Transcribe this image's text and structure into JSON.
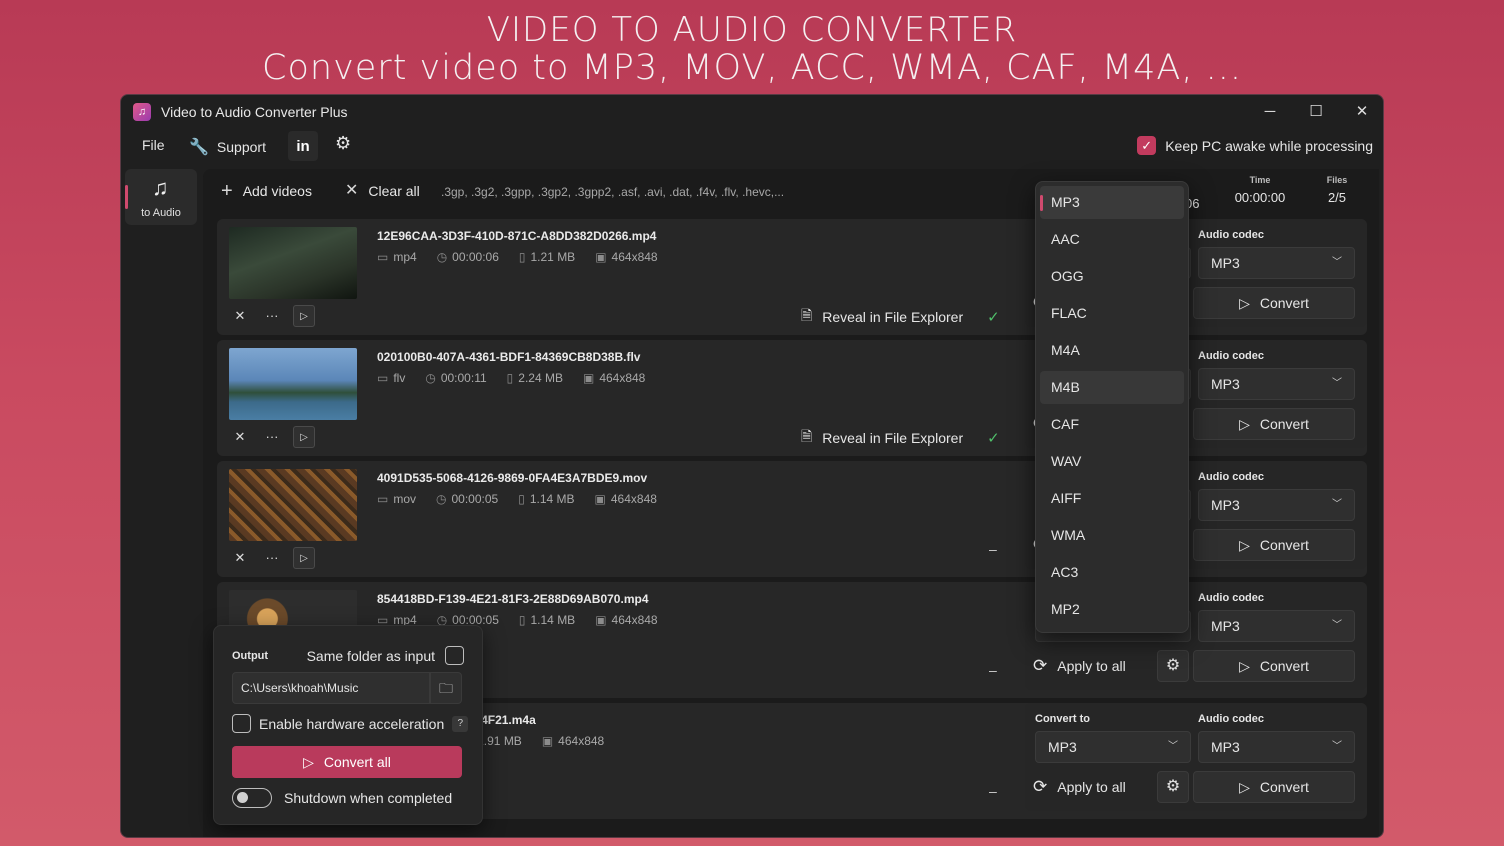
{
  "promo": {
    "line1": "VIDEO TO AUDIO CONVERTER",
    "line2": "Convert video to MP3, MOV, ACC, WMA, CAF, M4A, ..."
  },
  "window": {
    "title": "Video to Audio Converter Plus",
    "minimize": "─",
    "maximize": "☐",
    "close": "✕"
  },
  "menu": {
    "file": "File",
    "support": "Support",
    "linkedin": "in",
    "keep_awake": "Keep PC awake while processing",
    "keep_awake_checked": true
  },
  "nav": {
    "to_audio": "to Audio"
  },
  "toolbar": {
    "add_videos": "Add videos",
    "clear_all": "Clear all",
    "formats": ".3gp, .3g2, .3gpp, .3gp2, .3gpp2, .asf, .avi, .dat, .f4v, .flv, .hevc,...",
    "partial_stat_value": "06",
    "time_label": "Time",
    "time_value": "00:00:00",
    "files_label": "Files",
    "files_value": "2/5"
  },
  "labels": {
    "convert_to": "Convert to",
    "audio_codec": "Audio codec",
    "apply_to_all": "Apply to all",
    "convert": "Convert",
    "reveal": "Reveal in File Explorer",
    "dash": "–"
  },
  "files": [
    {
      "name": "12E96CAA-3D3F-410D-871C-A8DD382D0266.mp4",
      "ext": "mp4",
      "duration": "00:00:06",
      "size": "1.21 MB",
      "resolution": "464x848",
      "target": "MP3",
      "codec": "MP3",
      "done": true
    },
    {
      "name": "020100B0-407A-4361-BDF1-84369CB8D38B.flv",
      "ext": "flv",
      "duration": "00:00:11",
      "size": "2.24 MB",
      "resolution": "464x848",
      "target": "MP3",
      "codec": "MP3",
      "done": true
    },
    {
      "name": "4091D535-5068-4126-9869-0FA4E3A7BDE9.mov",
      "ext": "mov",
      "duration": "00:00:05",
      "size": "1.14 MB",
      "resolution": "464x848",
      "target": "MP3",
      "codec": "MP3",
      "done": false
    },
    {
      "name": "854418BD-F139-4E21-81F3-2E88D69AB070.mp4",
      "ext": "mp4",
      "duration": "00:00:05",
      "size": "1.14 MB",
      "resolution": "464x848",
      "target": "MP3",
      "codec": "MP3",
      "done": false
    },
    {
      "name": "F1-8391-F115B8644F21.m4a",
      "ext": "",
      "duration": ":09",
      "size": "1.91 MB",
      "resolution": "464x848",
      "target": "MP3",
      "codec": "MP3",
      "done": false
    }
  ],
  "format_dropdown": {
    "selected": "MP3",
    "hovered": "M4B",
    "options": [
      "MP3",
      "AAC",
      "OGG",
      "FLAC",
      "M4A",
      "M4B",
      "CAF",
      "WAV",
      "AIFF",
      "WMA",
      "AC3",
      "MP2"
    ]
  },
  "output": {
    "label": "Output",
    "same_folder": "Same folder as input",
    "same_folder_checked": false,
    "path": "C:\\Users\\khoah\\Music",
    "hw_accel": "Enable hardware acceleration",
    "hw_accel_checked": false,
    "help": "?",
    "convert_all": "Convert all",
    "shutdown": "Shutdown when completed",
    "shutdown_on": false
  },
  "icons": {
    "app": "music-note-app-icon",
    "support": "wrench-icon",
    "settings": "gear-sparkle-icon",
    "add": "plus-icon",
    "clear": "close-icon",
    "remove": "close-icon",
    "more": "ellipsis-icon",
    "play": "play-icon",
    "reveal": "file-explorer-icon",
    "check": "check-icon",
    "refresh": "refresh-icon",
    "gear": "gear-icon",
    "folder": "folder-icon",
    "chevron": "chevron-down-icon"
  },
  "colors": {
    "accent": "#c23b5e",
    "success": "#4fbf6a",
    "background": "#1f1f1f"
  }
}
